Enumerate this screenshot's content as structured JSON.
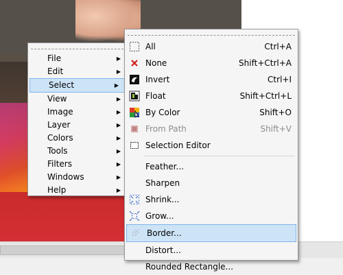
{
  "main_menu": {
    "items": [
      {
        "label": "File",
        "arrow": "▶"
      },
      {
        "label": "Edit",
        "arrow": "▶"
      },
      {
        "label": "Select",
        "arrow": "▶"
      },
      {
        "label": "View",
        "arrow": "▶"
      },
      {
        "label": "Image",
        "arrow": "▶"
      },
      {
        "label": "Layer",
        "arrow": "▶"
      },
      {
        "label": "Colors",
        "arrow": "▶"
      },
      {
        "label": "Tools",
        "arrow": "▶"
      },
      {
        "label": "Filters",
        "arrow": "▶"
      },
      {
        "label": "Windows",
        "arrow": "▶"
      },
      {
        "label": "Help",
        "arrow": "▶"
      }
    ],
    "highlighted": "Select"
  },
  "select_menu": {
    "items": [
      {
        "label": "All",
        "shortcut": "Ctrl+A",
        "icon": "select-all-icon"
      },
      {
        "label": "None",
        "shortcut": "Shift+Ctrl+A",
        "icon": "select-none-icon"
      },
      {
        "label": "Invert",
        "shortcut": "Ctrl+I",
        "icon": "invert-icon"
      },
      {
        "label": "Float",
        "shortcut": "Shift+Ctrl+L",
        "icon": "float-icon"
      },
      {
        "label": "By Color",
        "shortcut": "Shift+O",
        "icon": "by-color-icon"
      },
      {
        "label": "From Path",
        "shortcut": "Shift+V",
        "icon": "from-path-icon",
        "disabled": true
      },
      {
        "label": "Selection Editor",
        "shortcut": "",
        "icon": "selection-editor-icon"
      },
      {
        "label": "Feather...",
        "shortcut": "",
        "icon": ""
      },
      {
        "label": "Sharpen",
        "shortcut": "",
        "icon": ""
      },
      {
        "label": "Shrink...",
        "shortcut": "",
        "icon": "shrink-icon"
      },
      {
        "label": "Grow...",
        "shortcut": "",
        "icon": "grow-icon"
      },
      {
        "label": "Border...",
        "shortcut": "",
        "icon": "border-icon"
      },
      {
        "label": "Distort...",
        "shortcut": "",
        "icon": ""
      },
      {
        "label": "Rounded Rectangle...",
        "shortcut": "",
        "icon": ""
      }
    ],
    "highlighted": "Border..."
  },
  "colors": {
    "highlight_bg": "#cde4f7",
    "highlight_border": "#7eb4ea",
    "menu_bg": "#f5f5f5",
    "disabled_text": "#8c8c8c"
  }
}
